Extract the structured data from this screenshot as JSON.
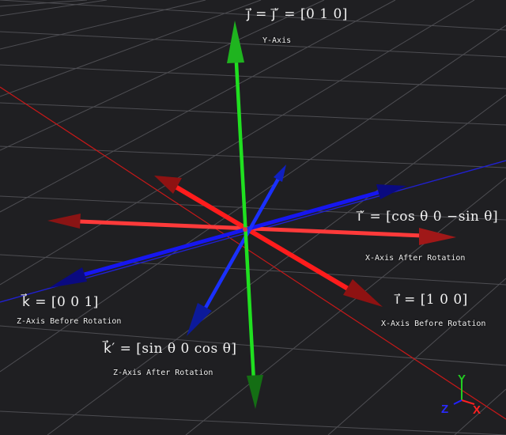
{
  "labels": {
    "j_formula": "j⃗ = j⃗′ = [0   1   0]",
    "j_caption": "Y-Axis",
    "i_prime_formula": "i⃗′ = [cos θ   0   −sin θ]",
    "i_prime_caption": "X-Axis After Rotation",
    "i_formula": "i⃗ = [1   0   0]",
    "i_caption": "X-Axis Before Rotation",
    "k_formula": "k⃗ = [0   0   1]",
    "k_caption": "Z-Axis Before Rotation",
    "k_prime_formula": "k⃗′ = [sin θ   0   cos θ]",
    "k_prime_caption": "Z-Axis After Rotation"
  },
  "gizmo": {
    "x_label": "X",
    "y_label": "Y",
    "z_label": "Z"
  },
  "colors": {
    "background": "#1f1f22",
    "grid": "#5a5a5e",
    "x_axis": "#ff2020",
    "y_axis": "#22dd22",
    "z_axis": "#1010ff",
    "rotated_x": "#ff4040",
    "rotated_z": "#1a2cff"
  }
}
